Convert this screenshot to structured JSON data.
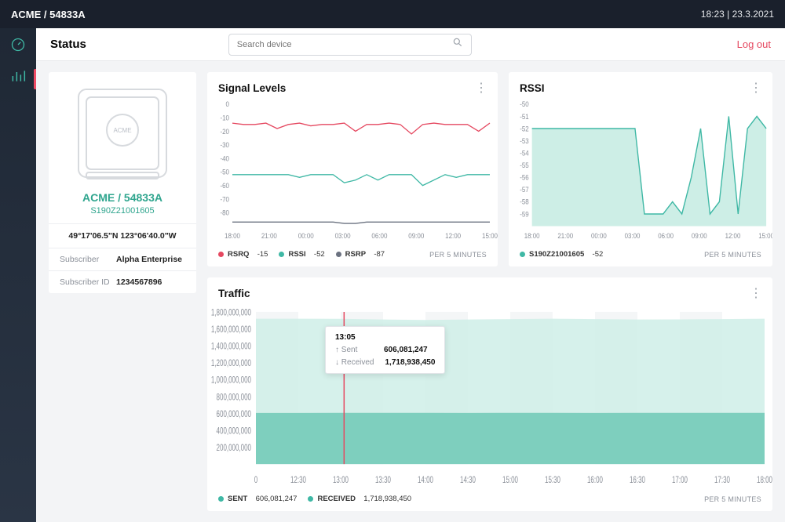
{
  "topbar": {
    "breadcrumb": "ACME / 54833A",
    "time": "18:23",
    "date": "23.3.2021"
  },
  "nav": {
    "items": [
      "dashboard",
      "stats"
    ],
    "active_index": 1
  },
  "page": {
    "title": "Status",
    "search_placeholder": "Search device",
    "logout": "Log out"
  },
  "device": {
    "logo_label": "ACME",
    "name": "ACME / 54833A",
    "serial": "S190Z21001605",
    "coords": "49°17'06.5\"N 123°06'40.0\"W",
    "rows": [
      {
        "k": "Subscriber",
        "v": "Alpha Enterprise"
      },
      {
        "k": "Subscriber ID",
        "v": "1234567896"
      }
    ]
  },
  "signal": {
    "title": "Signal Levels",
    "per": "PER 5 MINUTES",
    "legend": [
      {
        "name": "RSRQ",
        "value": "-15",
        "color": "#e54860"
      },
      {
        "name": "RSSI",
        "value": "-52",
        "color": "#3fb8a5"
      },
      {
        "name": "RSRP",
        "value": "-87",
        "color": "#6b7280"
      }
    ]
  },
  "rssi": {
    "title": "RSSI",
    "per": "PER 5 MINUTES",
    "legend": [
      {
        "name": "S190Z21001605",
        "value": "-52",
        "color": "#3fb8a5"
      }
    ]
  },
  "traffic": {
    "title": "Traffic",
    "per": "PER 5 MINUTES",
    "legend": [
      {
        "name": "SENT",
        "value": "606,081,247",
        "color": "#3fb8a5"
      },
      {
        "name": "RECEIVED",
        "value": "1,718,938,450",
        "color": "#3fb8a5"
      }
    ],
    "tooltip": {
      "time": "13:05",
      "rows": [
        {
          "k": "Sent",
          "v": "606,081,247"
        },
        {
          "k": "Received",
          "v": "1,718,938,450"
        }
      ]
    }
  },
  "chart_data": [
    {
      "type": "line",
      "title": "Signal Levels",
      "xlabel": "",
      "ylabel": "",
      "x_ticks": [
        "18:00",
        "21:00",
        "00:00",
        "03:00",
        "06:00",
        "09:00",
        "12:00",
        "15:00"
      ],
      "ylim": [
        -90,
        0
      ],
      "y_ticks": [
        0,
        -10,
        -20,
        -30,
        -40,
        -50,
        -60,
        -70,
        -80
      ],
      "series": [
        {
          "name": "RSRQ",
          "color": "#e54860",
          "values": [
            -14,
            -15,
            -15,
            -14,
            -18,
            -15,
            -14,
            -16,
            -15,
            -15,
            -14,
            -20,
            -15,
            -15,
            -14,
            -15,
            -22,
            -15,
            -14,
            -15,
            -15,
            -15,
            -20,
            -14
          ]
        },
        {
          "name": "RSSI",
          "color": "#3fb8a5",
          "values": [
            -52,
            -52,
            -52,
            -52,
            -52,
            -52,
            -54,
            -52,
            -52,
            -52,
            -58,
            -56,
            -52,
            -56,
            -52,
            -52,
            -52,
            -60,
            -56,
            -52,
            -54,
            -52,
            -52,
            -52
          ]
        },
        {
          "name": "RSRP",
          "color": "#6b7280",
          "values": [
            -87,
            -87,
            -87,
            -87,
            -87,
            -87,
            -87,
            -87,
            -87,
            -87,
            -88,
            -88,
            -87,
            -87,
            -87,
            -87,
            -87,
            -87,
            -87,
            -87,
            -87,
            -87,
            -87,
            -87
          ]
        }
      ]
    },
    {
      "type": "area",
      "title": "RSSI",
      "xlabel": "",
      "ylabel": "",
      "x_ticks": [
        "18:00",
        "21:00",
        "00:00",
        "03:00",
        "06:00",
        "09:00",
        "12:00",
        "15:00"
      ],
      "ylim": [
        -60,
        -50
      ],
      "y_ticks": [
        -50,
        -51,
        -52,
        -53,
        -54,
        -55,
        -56,
        -57,
        -58,
        -59
      ],
      "series": [
        {
          "name": "S190Z21001605",
          "color": "#3fb8a5",
          "values": [
            -52,
            -52,
            -52,
            -52,
            -52,
            -52,
            -52,
            -52,
            -52,
            -52,
            -52,
            -52,
            -59,
            -59,
            -59,
            -58,
            -59,
            -56,
            -52,
            -59,
            -58,
            -51,
            -59,
            -52,
            -51,
            -52
          ]
        }
      ]
    },
    {
      "type": "area",
      "title": "Traffic",
      "xlabel": "",
      "ylabel": "",
      "x_ticks": [
        "0",
        "12:30",
        "13:00",
        "13:30",
        "14:00",
        "14:30",
        "15:00",
        "15:30",
        "16:00",
        "16:30",
        "17:00",
        "17:30",
        "18:00"
      ],
      "ylim": [
        0,
        1800000000
      ],
      "y_ticks": [
        200000000,
        400000000,
        600000000,
        800000000,
        1000000000,
        1200000000,
        1400000000,
        1600000000,
        1800000000
      ],
      "cursor_x": "13:05",
      "series": [
        {
          "name": "Received",
          "color": "#cfeee7",
          "values": [
            1720000000,
            1720000000,
            1718938450,
            1710000000,
            1705000000,
            1710000000,
            1715000000,
            1720000000,
            1715000000,
            1710000000,
            1712000000,
            1715000000,
            1720000000
          ]
        },
        {
          "name": "Sent",
          "color": "#6ec9b6",
          "values": [
            605000000,
            605000000,
            606081247,
            606000000,
            606000000,
            605000000,
            606000000,
            606000000,
            605000000,
            606000000,
            606000000,
            606000000,
            606000000
          ]
        }
      ]
    }
  ]
}
